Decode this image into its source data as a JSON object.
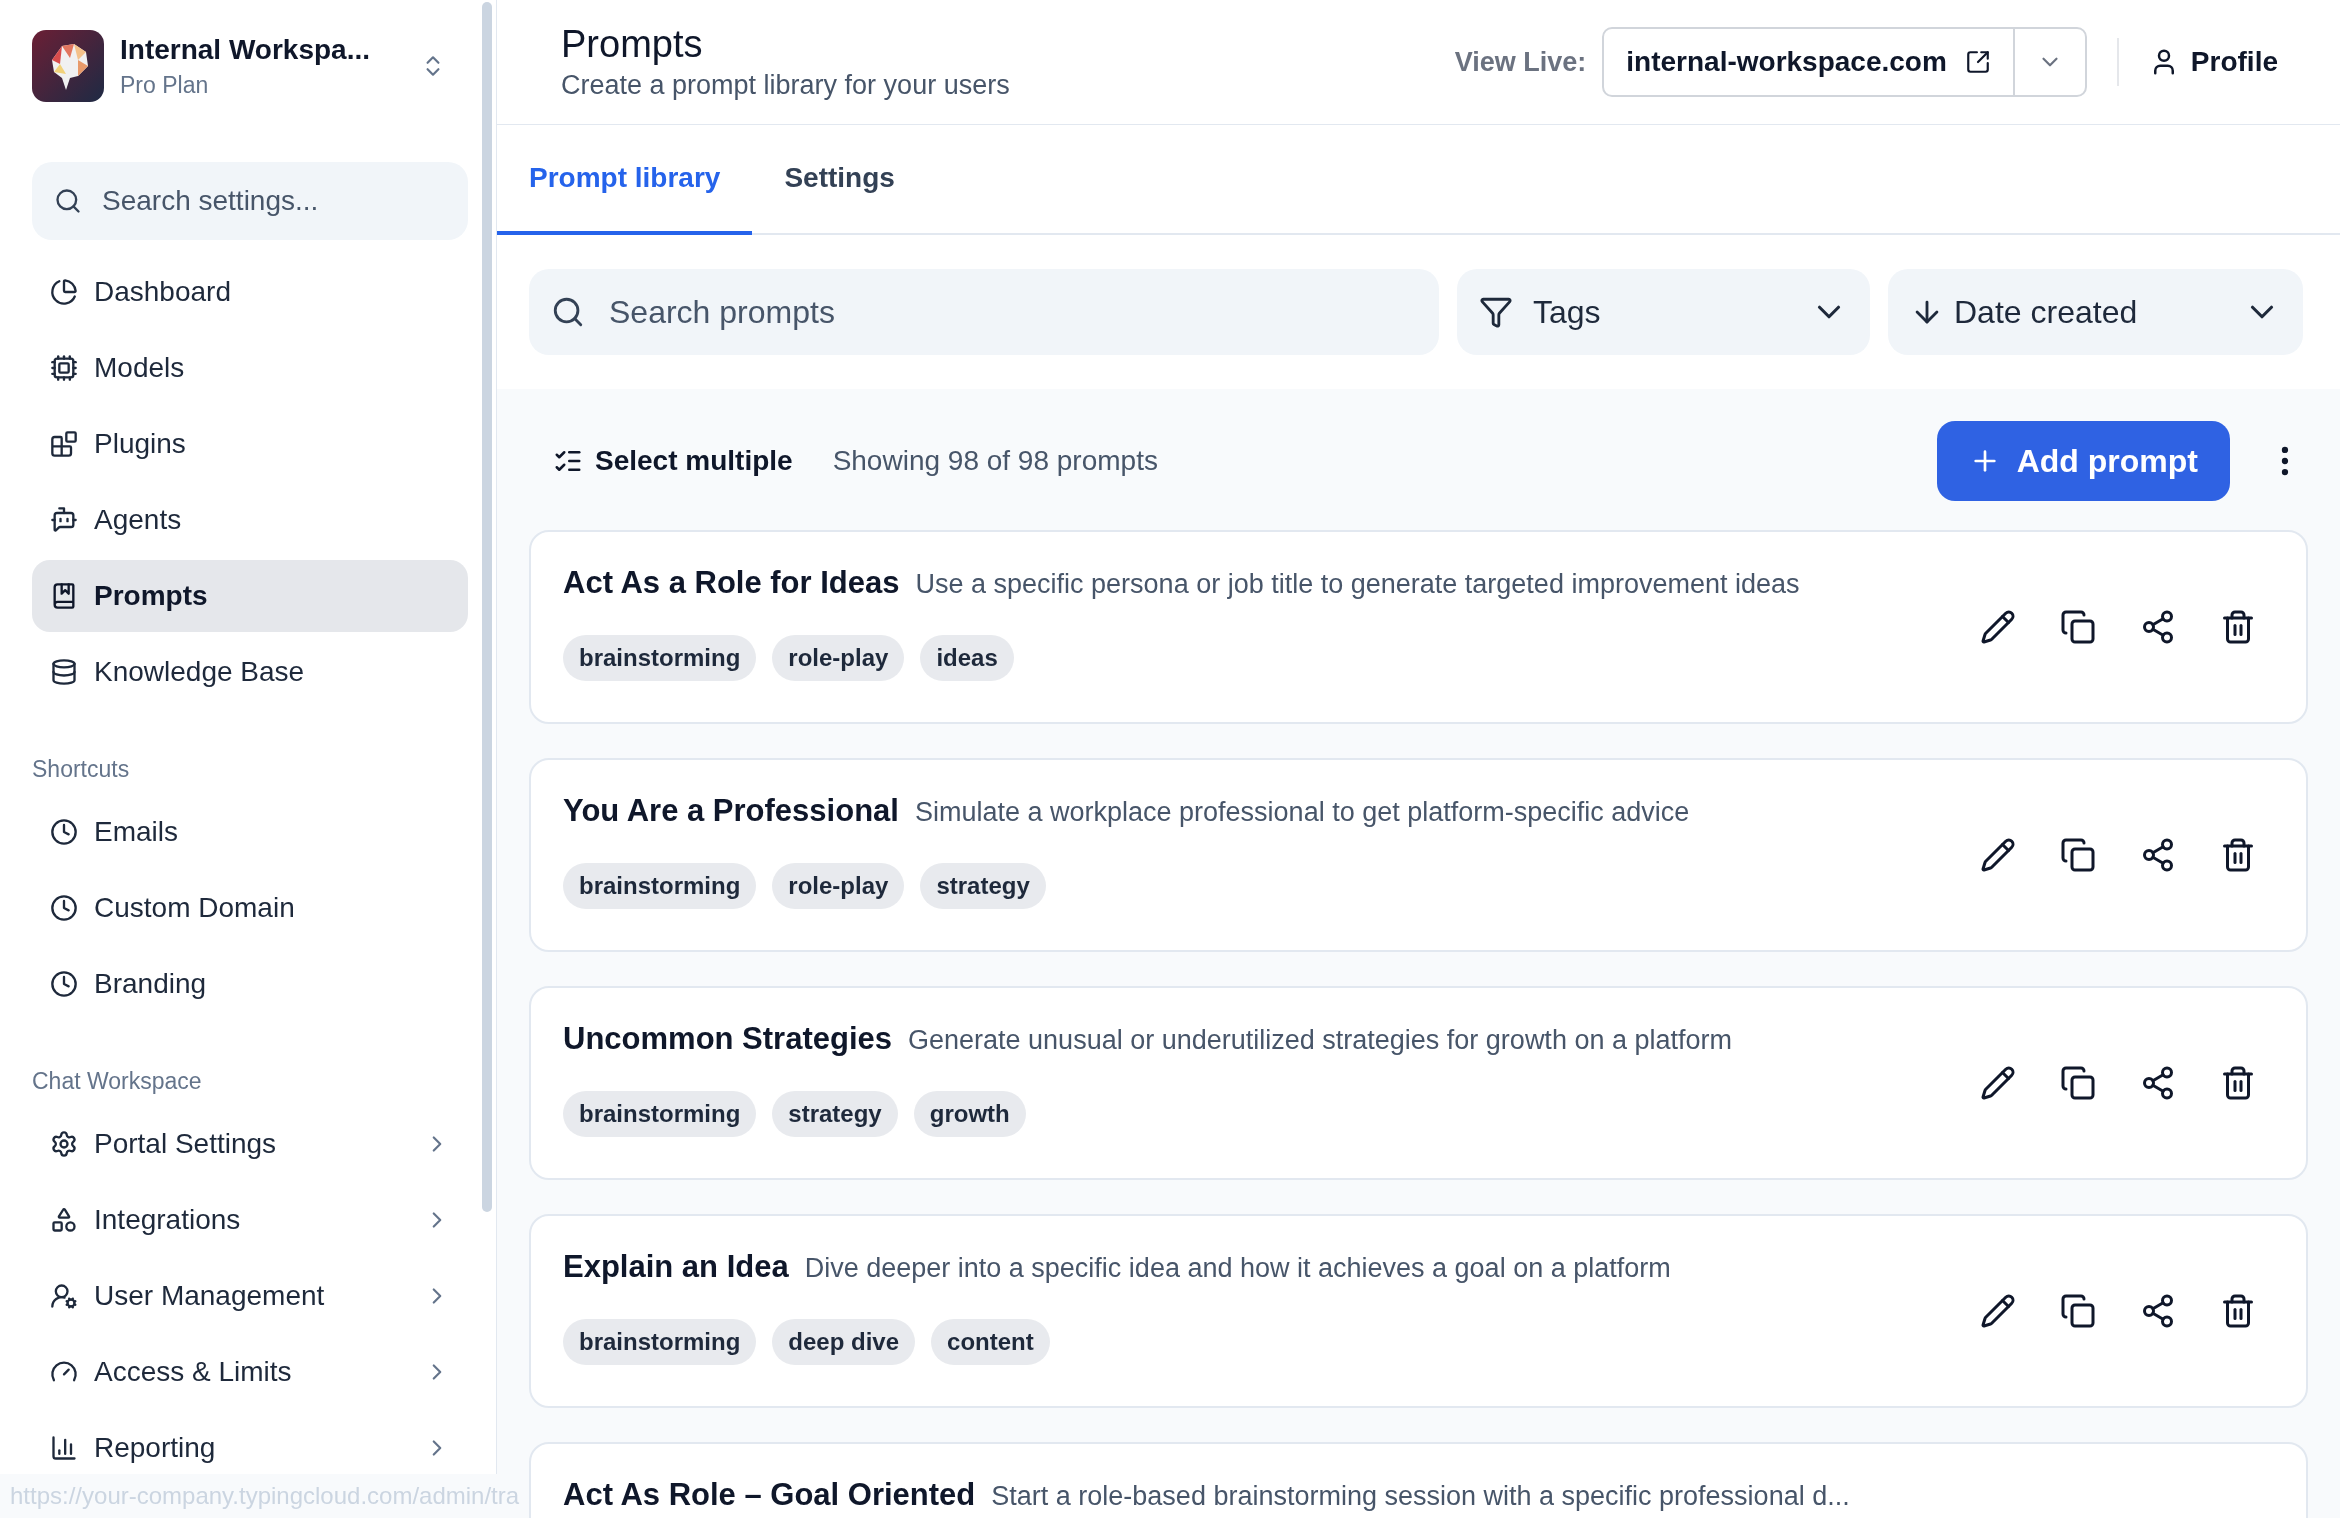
{
  "workspace": {
    "name": "Internal Workspa...",
    "plan": "Pro Plan"
  },
  "sidebar": {
    "search": {
      "placeholder": "Search settings..."
    },
    "sections": [
      {
        "items": [
          {
            "label": "Dashboard",
            "selected": false
          },
          {
            "label": "Models",
            "selected": false
          },
          {
            "label": "Plugins",
            "selected": false
          },
          {
            "label": "Agents",
            "selected": false
          },
          {
            "label": "Prompts",
            "selected": true
          },
          {
            "label": "Knowledge Base",
            "selected": false
          }
        ]
      },
      {
        "heading": "Shortcuts",
        "items": [
          {
            "label": "Emails",
            "selected": false
          },
          {
            "label": "Custom Domain",
            "selected": false
          },
          {
            "label": "Branding",
            "selected": false
          }
        ]
      },
      {
        "heading": "Chat Workspace",
        "items": [
          {
            "label": "Portal Settings",
            "selected": false,
            "expanded": false
          },
          {
            "label": "Integrations",
            "selected": false,
            "expanded": false
          },
          {
            "label": "User Management",
            "selected": false,
            "expanded": false
          },
          {
            "label": "Access & Limits",
            "selected": false,
            "expanded": false
          },
          {
            "label": "Reporting",
            "selected": false,
            "expanded": false
          }
        ]
      }
    ]
  },
  "header": {
    "title": "Prompts",
    "subtitle": "Create a prompt library for your users",
    "view_live_label": "View Live:",
    "domain": "internal-workspace.com",
    "profile": "Profile"
  },
  "tabs": [
    {
      "label": "Prompt library",
      "selected": true
    },
    {
      "label": "Settings",
      "selected": false
    }
  ],
  "filters": {
    "search": {
      "placeholder": "Search prompts"
    },
    "tags": "Tags",
    "sort": "Date created"
  },
  "toolbar": {
    "select_multiple": "Select multiple",
    "count": "Showing 98 of 98 prompts",
    "add_button": "Add prompt"
  },
  "prompts": [
    {
      "title": "Act As a Role for Ideas",
      "description": "Use a specific persona or job title to generate targeted improvement ideas",
      "tags": [
        "brainstorming",
        "role-play",
        "ideas"
      ]
    },
    {
      "title": "You Are a Professional",
      "description": "Simulate a workplace professional to get platform-specific advice",
      "tags": [
        "brainstorming",
        "role-play",
        "strategy"
      ]
    },
    {
      "title": "Uncommon Strategies",
      "description": "Generate unusual or underutilized strategies for growth on a platform",
      "tags": [
        "brainstorming",
        "strategy",
        "growth"
      ]
    },
    {
      "title": "Explain an Idea",
      "description": "Dive deeper into a specific idea and how it achieves a goal on a platform",
      "tags": [
        "brainstorming",
        "deep dive",
        "content"
      ]
    },
    {
      "title": "Act As Role – Goal Oriented",
      "description": "Start a role-based brainstorming session with a specific professional d..."
    }
  ],
  "status_url": "https://your-company.typingcloud.com/admin/tra"
}
